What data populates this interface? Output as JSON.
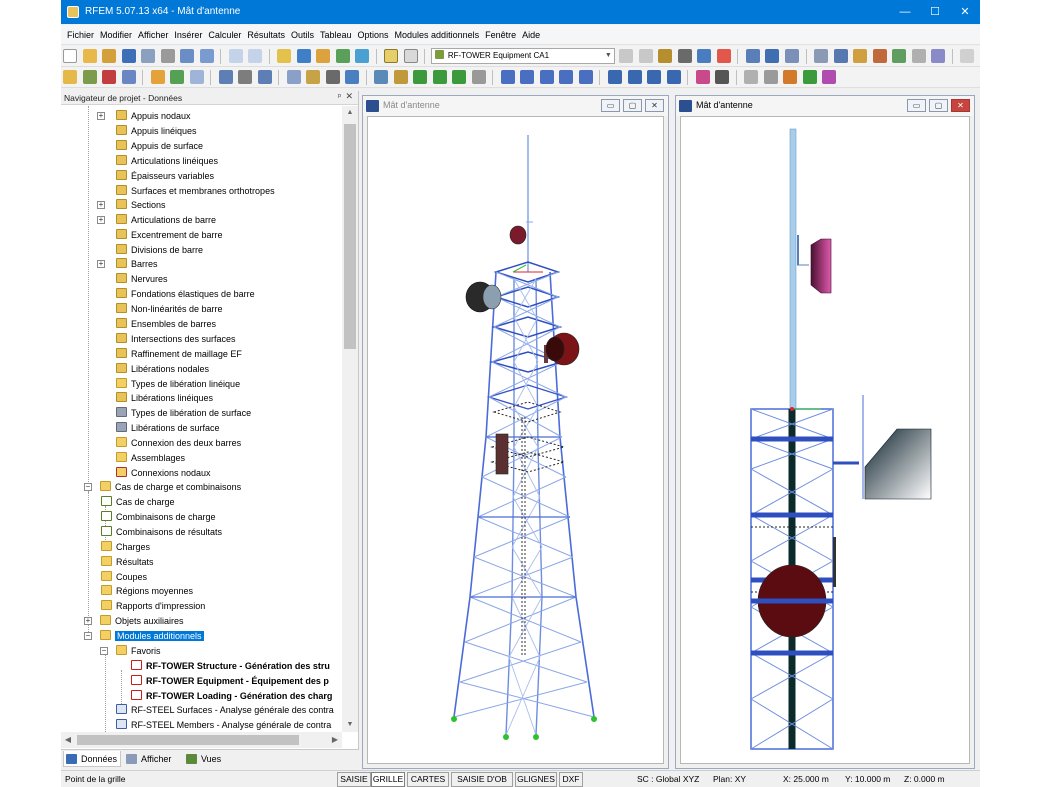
{
  "window": {
    "title": "RFEM 5.07.13 x64 - Mât d'antenne",
    "controls": [
      "—",
      "☐",
      "✕"
    ]
  },
  "menu": [
    "Fichier",
    "Modifier",
    "Afficher",
    "Insérer",
    "Calculer",
    "Résultats",
    "Outils",
    "Tableau",
    "Options",
    "Modules additionnels",
    "Fenêtre",
    "Aide"
  ],
  "toolbar": {
    "loadcase_selector": "RF-TOWER Equipment CA1"
  },
  "navigator": {
    "title": "Navigateur de projet - Données",
    "pin": "ᵖ",
    "close": "✕",
    "items": [
      {
        "label": "Appuis nodaux",
        "expander": "+"
      },
      {
        "label": "Appuis linéiques"
      },
      {
        "label": "Appuis de surface"
      },
      {
        "label": "Articulations linéiques"
      },
      {
        "label": "Épaisseurs variables"
      },
      {
        "label": "Surfaces et membranes orthotropes"
      },
      {
        "label": "Sections",
        "expander": "+"
      },
      {
        "label": "Articulations de barre",
        "expander": "+"
      },
      {
        "label": "Excentrement de barre"
      },
      {
        "label": "Divisions de barre"
      },
      {
        "label": "Barres",
        "expander": "+"
      },
      {
        "label": "Nervures"
      },
      {
        "label": "Fondations élastiques de barre"
      },
      {
        "label": "Non-linéarités de barre"
      },
      {
        "label": "Ensembles de barres"
      },
      {
        "label": "Intersections des surfaces"
      },
      {
        "label": "Raffinement de maillage EF"
      },
      {
        "label": "Libérations nodales"
      },
      {
        "label": "Types de libération linéique"
      },
      {
        "label": "Libérations linéiques"
      },
      {
        "label": "Types de libération de surface"
      },
      {
        "label": "Libérations de surface"
      },
      {
        "label": "Connexion des deux barres"
      },
      {
        "label": "Assemblages"
      },
      {
        "label": "Connexions nodaux"
      },
      {
        "label": "Cas de charge et combinaisons",
        "expander": "−"
      },
      {
        "label": "Cas de charge"
      },
      {
        "label": "Combinaisons de charge"
      },
      {
        "label": "Combinaisons de résultats"
      },
      {
        "label": "Charges"
      },
      {
        "label": "Résultats"
      },
      {
        "label": "Coupes"
      },
      {
        "label": "Régions moyennes"
      },
      {
        "label": "Rapports d'impression"
      },
      {
        "label": "Objets auxiliaires",
        "expander": "+"
      },
      {
        "label": "Modules additionnels",
        "expander": "−"
      },
      {
        "label": "Favoris",
        "expander": "−"
      },
      {
        "label": "RF-TOWER Structure - Génération des stru"
      },
      {
        "label": "RF-TOWER Equipment - Équipement des p"
      },
      {
        "label": "RF-TOWER Loading - Génération des charg"
      },
      {
        "label": "RF-STEEL Surfaces - Analyse générale des contra"
      },
      {
        "label": "RF-STEEL Members - Analyse générale de contra"
      }
    ],
    "tabs": [
      "Données",
      "Afficher",
      "Vues"
    ]
  },
  "views": {
    "left_title": "Mât d'antenne",
    "right_title": "Mât d'antenne",
    "window_buttons": [
      "▭",
      "▢",
      "✕"
    ]
  },
  "statusbar": {
    "hint": "Point de la grille",
    "modes": [
      "SAISIE",
      "GRILLE",
      "CARTES",
      "SAISIE D'OB",
      "GLIGNES",
      "DXF"
    ],
    "active_mode": "GRILLE",
    "coord_system": "SC : Global XYZ",
    "plane": "Plan: XY",
    "x": "X:  25.000 m",
    "y": "Y:  10.000 m",
    "z": "Z:  0.000 m"
  },
  "colors": {
    "titlebar": "#0078d7",
    "structure_blue": "#4b6cd8",
    "member_light": "#8aa6e8",
    "support_green": "#2ec22e",
    "dish_red": "#7a1416",
    "selection": "#0078d7"
  }
}
